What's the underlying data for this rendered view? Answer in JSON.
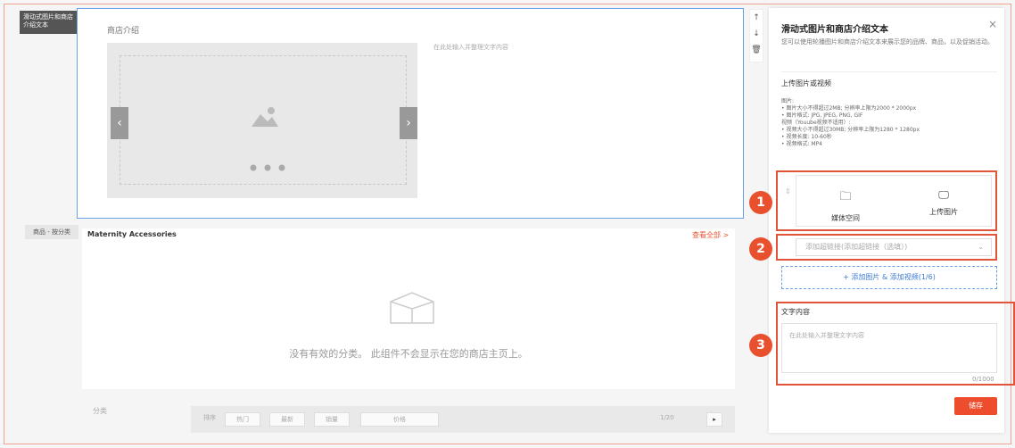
{
  "left_labels": {
    "component_label": "滑动式图片和商店介绍文本",
    "category_label": "商品 - 按分类"
  },
  "shop_intro": {
    "title": "商店介绍",
    "text_placeholder": "在此处输入并整理文字内容"
  },
  "side_tools": [
    "↑",
    "↓",
    "🗑"
  ],
  "section2": {
    "title": "Maternity Accessories",
    "view_all": "查看全部 >",
    "empty_message": "没有有效的分类。 此组件不会显示在您的商店主页上。"
  },
  "bottom_bar": {
    "category_label": "分类",
    "sort_label": "排序",
    "chips": [
      "热门",
      "最新",
      "销量",
      "价格"
    ],
    "pagination": "1/20"
  },
  "panel": {
    "title": "滑动式图片和商店介绍文本",
    "close": "×",
    "description": "您可以使用轮播图片和商店介绍文本来展示您的品牌、商品，以及促销活动。",
    "upload_title": "上传图片或视频",
    "requirements": "图片:\n• 图片大小不得超过2MB; 分辨率上限为2000 * 2000px\n• 图片格式: JPG, JPEG, PNG, GIF\n视频（Youube视频不适用）:\n• 视频大小不得超过30MB; 分辨率上限为1280 * 1280px\n• 视频长度: 10-60秒\n• 视频格式: MP4",
    "media_space": "媒体空间",
    "upload_image": "上传图片",
    "link_placeholder": "添加超链接(添加超链接（选填）)",
    "add_button": "+ 添加图片 & 添加视频(1/6)",
    "text_title": "文字内容",
    "text_placeholder": "在此处输入并整理文字内容",
    "counter": "0/1000",
    "save": "储存"
  },
  "markers": [
    "1",
    "2",
    "3"
  ],
  "colors": {
    "accent": "#ee4d2d",
    "highlight": "#e0553a",
    "selection": "#6aa0e6"
  }
}
